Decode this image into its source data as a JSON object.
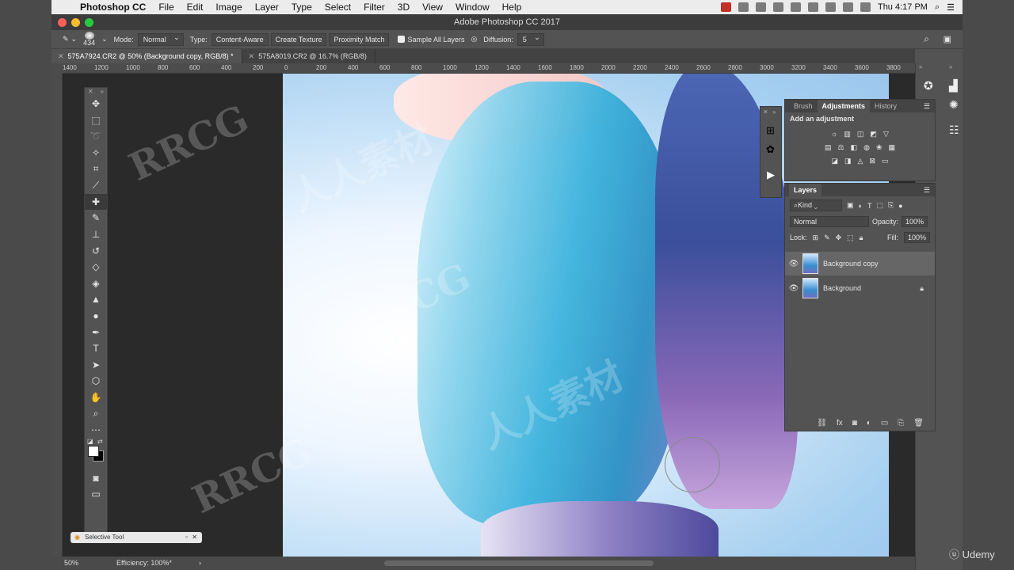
{
  "menubar": {
    "app_name": "Photoshop CC",
    "items": [
      "File",
      "Edit",
      "Image",
      "Layer",
      "Type",
      "Select",
      "Filter",
      "3D",
      "View",
      "Window",
      "Help"
    ],
    "clock": "Thu 4:17 PM"
  },
  "window": {
    "title": "Adobe Photoshop CC 2017"
  },
  "options": {
    "brush_size": "434",
    "mode_label": "Mode:",
    "mode_value": "Normal",
    "type_label": "Type:",
    "type_buttons": [
      "Content-Aware",
      "Create Texture",
      "Proximity Match"
    ],
    "sample_all_layers": "Sample All Layers",
    "diffusion_label": "Diffusion:",
    "diffusion_value": "5"
  },
  "tabs": [
    {
      "label": "575A7924.CR2 @ 50% (Background copy, RGB/8) *",
      "active": true
    },
    {
      "label": "575A8019.CR2 @ 16.7% (RGB/8)",
      "active": false
    }
  ],
  "ruler": {
    "ticks": [
      "1400",
      "1200",
      "1000",
      "800",
      "600",
      "400",
      "200",
      "0",
      "200",
      "400",
      "600",
      "800",
      "1000",
      "1200",
      "1400",
      "1600",
      "1800",
      "2000",
      "2200",
      "2400",
      "2600",
      "2800",
      "3000",
      "3200",
      "3400",
      "3600",
      "3800"
    ]
  },
  "status": {
    "zoom": "50%",
    "efficiency": "Efficiency: 100%*"
  },
  "selective_tool": {
    "label": "Selective Tool"
  },
  "adjustments_panel": {
    "tabs": [
      "Brush",
      "Adjustments",
      "History"
    ],
    "active_tab": "Adjustments",
    "heading": "Add an adjustment"
  },
  "layers_panel": {
    "title": "Layers",
    "filter_kind": "Kind",
    "blend_mode": "Normal",
    "opacity_label": "Opacity:",
    "opacity_value": "100%",
    "lock_label": "Lock:",
    "fill_label": "Fill:",
    "fill_value": "100%",
    "layers": [
      {
        "name": "Background copy",
        "selected": true,
        "locked": false
      },
      {
        "name": "Background",
        "selected": false,
        "locked": true
      }
    ]
  },
  "watermarks": [
    "RRCG",
    "人人素材",
    "RRCG",
    "人人素材",
    "RRCG"
  ],
  "branding": {
    "udemy": "Udemy"
  }
}
